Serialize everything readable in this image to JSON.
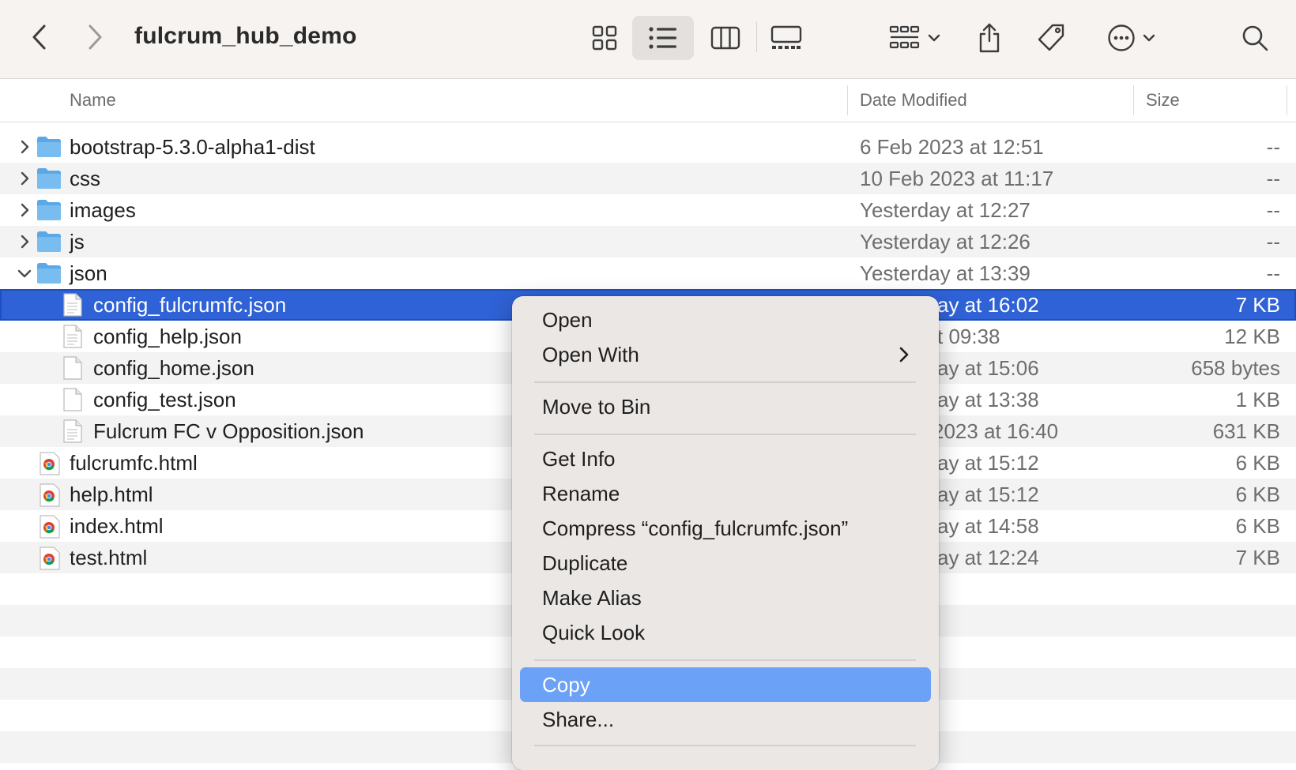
{
  "window": {
    "title": "fulcrum_hub_demo"
  },
  "toolbar": {
    "back_icon": "chevron-left-icon",
    "forward_icon": "chevron-right-icon",
    "views": [
      "icon-view-icon",
      "list-view-icon",
      "column-view-icon",
      "gallery-view-icon"
    ],
    "active_view": "list-view-icon",
    "group_icon": "group-by-icon",
    "share_icon": "share-icon",
    "tag_icon": "tag-icon",
    "action_icon": "more-actions-icon",
    "search_icon": "search-icon"
  },
  "columns": {
    "name": "Name",
    "date": "Date Modified",
    "size": "Size"
  },
  "files": [
    {
      "name": "bootstrap-5.3.0-alpha1-dist",
      "date": "6 Feb 2023 at 12:51",
      "size": "--",
      "kind": "folder",
      "disclosure": "collapsed"
    },
    {
      "name": "css",
      "date": "10 Feb 2023 at 11:17",
      "size": "--",
      "kind": "folder",
      "disclosure": "collapsed"
    },
    {
      "name": "images",
      "date": "Yesterday at 12:27",
      "size": "--",
      "kind": "folder",
      "disclosure": "collapsed"
    },
    {
      "name": "js",
      "date": "Yesterday at 12:26",
      "size": "--",
      "kind": "folder",
      "disclosure": "collapsed"
    },
    {
      "name": "json",
      "date": "Yesterday at 13:39",
      "size": "--",
      "kind": "folder",
      "disclosure": "expanded"
    },
    {
      "name": "config_fulcrumfc.json",
      "date": "ay at 16:02",
      "size": "7 KB",
      "kind": "json",
      "selected": true
    },
    {
      "name": "config_help.json",
      "date": "t 09:38",
      "size": "12 KB",
      "kind": "json"
    },
    {
      "name": "config_home.json",
      "date": "ay at 15:06",
      "size": "658 bytes",
      "kind": "blank"
    },
    {
      "name": "config_test.json",
      "date": "ay at 13:38",
      "size": "1 KB",
      "kind": "blank"
    },
    {
      "name": "Fulcrum FC v Opposition.json",
      "date": "2023 at 16:40",
      "size": "631 KB",
      "kind": "json"
    },
    {
      "name": "fulcrumfc.html",
      "date": "ay at 15:12",
      "size": "6 KB",
      "kind": "html"
    },
    {
      "name": "help.html",
      "date": "ay at 15:12",
      "size": "6 KB",
      "kind": "html"
    },
    {
      "name": "index.html",
      "date": "ay at 14:58",
      "size": "6 KB",
      "kind": "html"
    },
    {
      "name": "test.html",
      "date": "ay at 12:24",
      "size": "7 KB",
      "kind": "html"
    }
  ],
  "context_menu": {
    "items": [
      {
        "label": "Open"
      },
      {
        "label": "Open With",
        "submenu": true
      },
      {
        "label": "Move to Bin"
      },
      {
        "label": "Get Info"
      },
      {
        "label": "Rename"
      },
      {
        "label": "Compress “config_fulcrumfc.json”"
      },
      {
        "label": "Duplicate"
      },
      {
        "label": "Make Alias"
      },
      {
        "label": "Quick Look"
      },
      {
        "label": "Copy",
        "highlighted": true
      },
      {
        "label": "Share..."
      }
    ]
  },
  "colors": {
    "selection": "#2f62d6",
    "menu_highlight": "#6ba1f7",
    "folder": "#6bb3ea"
  }
}
